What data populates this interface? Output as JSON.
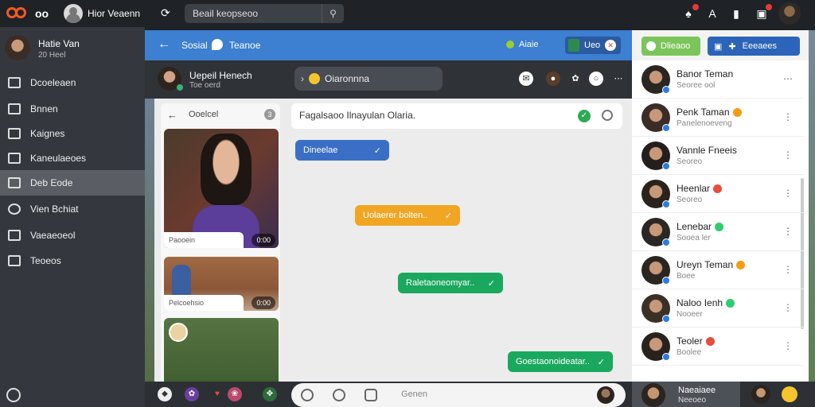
{
  "topbar": {
    "logo_text": "oo",
    "user_name": "Hior Veaenn",
    "search_text": "Beail keopseoo",
    "colors": {
      "brand": "#f15a24",
      "bar": "#1f2226"
    },
    "icons": [
      "refresh-icon",
      "pin-icon",
      "notification-icon",
      "text-icon",
      "bookmark-icon",
      "alert-icon"
    ]
  },
  "sidebar": {
    "profile": {
      "name": "Hatie Van",
      "sub": "20 Heel"
    },
    "items": [
      {
        "label": "Dcoeleaen",
        "icon": "grid-icon"
      },
      {
        "label": "Bnnen",
        "icon": "folder-icon"
      },
      {
        "label": "Kaignes",
        "icon": "tag-icon"
      },
      {
        "label": "Kaneulaeoes",
        "icon": "calendar-icon"
      },
      {
        "label": "Deb Eode",
        "icon": "code-icon",
        "active": true
      },
      {
        "label": "Vien Bchiat",
        "icon": "chat-icon"
      },
      {
        "label": "Vaeaeoeol",
        "icon": "video-icon"
      },
      {
        "label": "Teoeos",
        "icon": "home-icon"
      }
    ]
  },
  "main_header": {
    "title": "Sosial",
    "subtitle": "Teanoe",
    "status": "Aiaie",
    "user_label": "Ueo"
  },
  "chat_header": {
    "name": "Uepeil Henech",
    "sub": "Toe oerd",
    "pill_text": "Oiaronnna"
  },
  "gallery": {
    "title": "Ooelcel",
    "count": "3",
    "photos": [
      {
        "caption": "Paooein",
        "time": "0:00"
      },
      {
        "caption": "Pelcoehsio",
        "time": "0:00"
      },
      {
        "caption": "",
        "time": ""
      }
    ]
  },
  "messages": {
    "doc_text": "Fagalsaoo Ilnayulan Olaria.",
    "bubbles": [
      {
        "text": "Dineelae",
        "color": "#3a6fc5"
      },
      {
        "text": "Uolaerer bolten..",
        "color": "#f0a623"
      },
      {
        "text": "Raletaoneomyar..",
        "color": "#1aa85f"
      },
      {
        "text": "Goestaonoideatar..",
        "color": "#1aa85f"
      }
    ]
  },
  "composer": {
    "placeholder": "Genen"
  },
  "right_panel": {
    "btn1": "Dlieaoo",
    "btn2": "Eeeaees",
    "contacts": [
      {
        "name": "Banor Teman",
        "sub": "Seoree ool",
        "av": "#2a2622"
      },
      {
        "name": "Penk Taman",
        "sub": "Panelenoeveng",
        "av": "#3a2d27"
      },
      {
        "name": "Vannle Fneeis",
        "sub": "Seoreo",
        "av": "#241f1c"
      },
      {
        "name": "Heenlar",
        "sub": "Seoreo",
        "av": "#2b221d"
      },
      {
        "name": "Lenebar",
        "sub": "Sooea ler",
        "av": "#2a2724"
      },
      {
        "name": "Ureyn Teman",
        "sub": "Boee",
        "av": "#2c2621"
      },
      {
        "name": "Naloo Ienh",
        "sub": "Nooeer",
        "av": "#3a3026"
      },
      {
        "name": "Teoler",
        "sub": "Boolee",
        "av": "#27221e"
      }
    ]
  },
  "right_bottom": {
    "name": "Naeaiaee",
    "sub": "Neeoeo"
  }
}
